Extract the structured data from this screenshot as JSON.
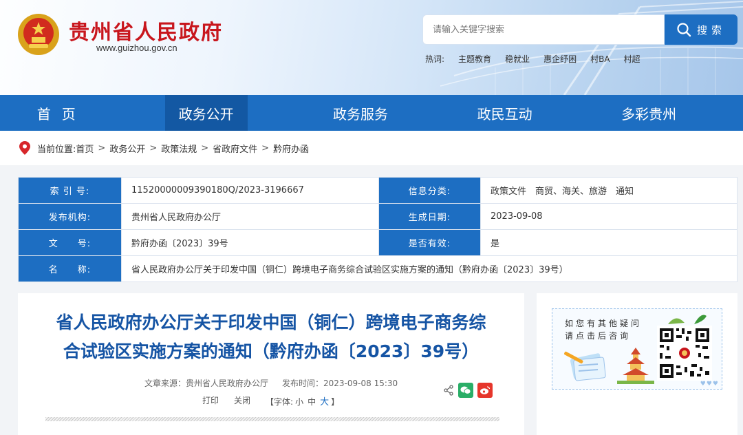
{
  "header": {
    "site_name": "贵州省人民政府",
    "site_url": "www.guizhou.gov.cn",
    "search": {
      "placeholder": "请输入关键字搜索",
      "button": "搜索"
    },
    "hotwords_label": "热词:",
    "hotwords": [
      "主题教育",
      "稳就业",
      "惠企纾困",
      "村BA",
      "村超"
    ]
  },
  "nav": {
    "items": [
      "首页",
      "政务公开",
      "政务服务",
      "政民互动",
      "多彩贵州"
    ],
    "active": "政务公开"
  },
  "breadcrumb": {
    "label": "当前位置:",
    "items": [
      "首页",
      "政务公开",
      "政策法规",
      "省政府文件",
      "黔府办函"
    ],
    "sep": ">"
  },
  "info": {
    "index_label": "索 引 号:",
    "index_value": "11520000009390180Q/2023-3196667",
    "category_label": "信息分类:",
    "category_value": "政策文件　商贸、海关、旅游　通知",
    "publisher_label": "发布机构:",
    "publisher_value": "贵州省人民政府办公厅",
    "date_label": "生成日期:",
    "date_value": "2023-09-08",
    "docno_label": "文　　号:",
    "docno_value": "黔府办函〔2023〕39号",
    "valid_label": "是否有效:",
    "valid_value": "是",
    "name_label": "名　　称:",
    "name_value": "省人民政府办公厅关于印发中国（铜仁）跨境电子商务综合试验区实施方案的通知（黔府办函〔2023〕39号）"
  },
  "article": {
    "title_line1": "省人民政府办公厅关于印发中国（铜仁）跨境电子商务综",
    "title_line2": "合试验区实施方案的通知（黔府办函〔2023〕39号）",
    "source": "文章来源：贵州省人民政府办公厅",
    "time": "发布时间：2023-09-08 15:30",
    "print": "打印",
    "close": "关闭",
    "font_prefix": "【字体:",
    "font_small": "小",
    "font_mid": "中",
    "font_big": "大",
    "font_suffix": "】"
  },
  "sidebar": {
    "qa_line1": "如您有其他疑问",
    "qa_line2": "请点击后咨询"
  },
  "colors": {
    "primary": "#1d6ec2",
    "active_nav": "#1358a3",
    "brand_red": "#c8161d",
    "title_blue": "#1554a4"
  }
}
